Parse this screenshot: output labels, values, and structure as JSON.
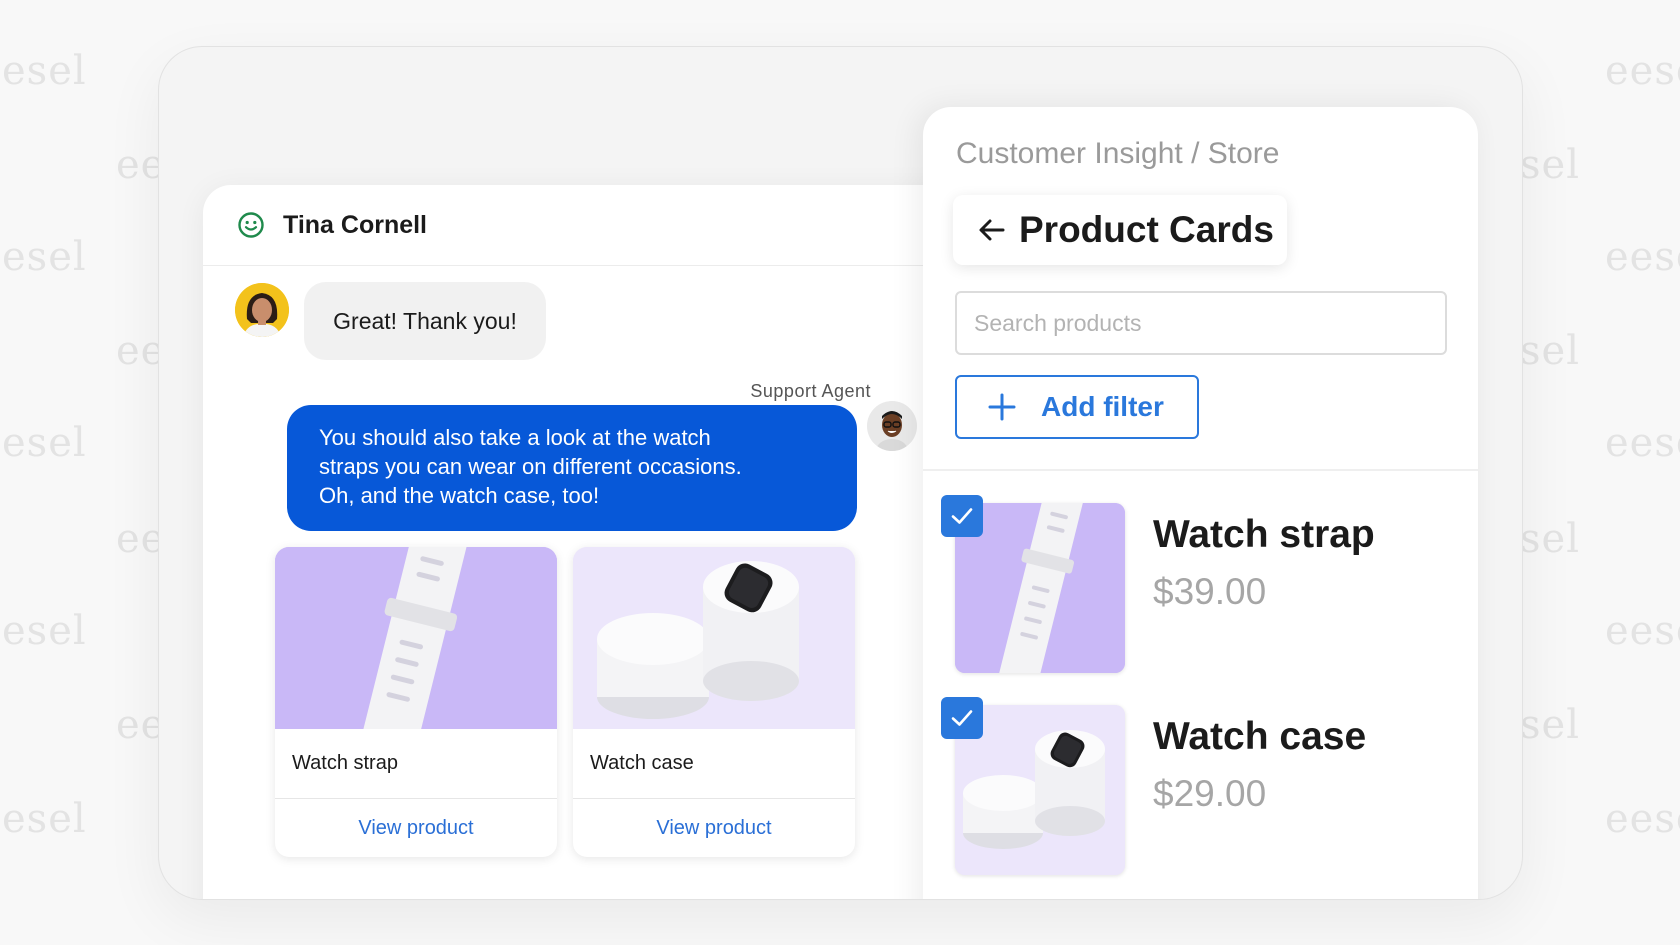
{
  "watermark": {
    "text_full": "esel",
    "text_left": "ee",
    "text_right_full": "eese",
    "text_right_part": "sel"
  },
  "chat": {
    "contact_name": "Tina Cornell",
    "customer_message": "Great! Thank you!",
    "agent_label": "Support Agent",
    "agent_message_lines": [
      "You should also take a look at the watch",
      "straps you can wear on different occasions.",
      "Oh, and the watch case, too!"
    ],
    "products": [
      {
        "name": "Watch strap",
        "link": "View product"
      },
      {
        "name": "Watch case",
        "link": "View product"
      }
    ]
  },
  "insight": {
    "breadcrumb": "Customer Insight / Store",
    "title": "Product Cards",
    "search_placeholder": "Search products",
    "add_filter_label": "Add filter",
    "items": [
      {
        "name": "Watch strap",
        "price": "$39.00",
        "checked": true
      },
      {
        "name": "Watch case",
        "price": "$29.00",
        "checked": true
      }
    ]
  },
  "colors": {
    "agent_bubble": "#0758d8",
    "accent_blue": "#2a78dc",
    "status_green": "#1f8a4c",
    "strap_bg": "#c9b8f7",
    "case_bg": "#ece6fb"
  },
  "icons": [
    "smile-icon",
    "back-arrow-icon",
    "plus-icon",
    "checkmark-icon"
  ]
}
